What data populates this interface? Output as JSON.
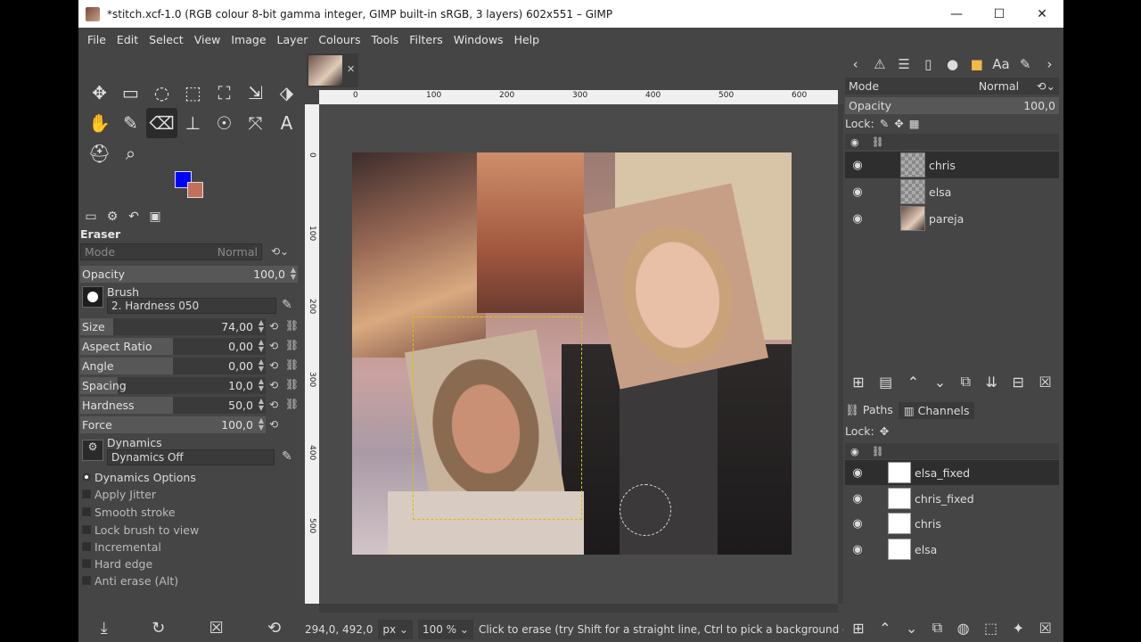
{
  "window": {
    "title": "*stitch.xcf-1.0 (RGB colour 8-bit gamma integer, GIMP built-in sRGB, 3 layers) 602x551 – GIMP",
    "minimize": "—",
    "maximize": "☐",
    "close": "✕"
  },
  "menu": [
    "File",
    "Edit",
    "Select",
    "View",
    "Image",
    "Layer",
    "Colours",
    "Tools",
    "Filters",
    "Windows",
    "Help"
  ],
  "tools": [
    "✥",
    "▭",
    "◌",
    "⬚",
    "⛶",
    "⇲",
    "⬗",
    "✋",
    "✎",
    "⌫",
    "⊥",
    "☉",
    "⤧",
    "A",
    "⛑",
    "⌕"
  ],
  "colors": {
    "foreground": "#0000ff",
    "background": "#c46e5c"
  },
  "tool_options": {
    "title": "Eraser",
    "mode_label": "Mode",
    "mode_value": "Normal",
    "opacity": {
      "label": "Opacity",
      "value": "100,0"
    },
    "brush_label": "Brush",
    "brush_value": "2. Hardness 050",
    "sliders": [
      {
        "label": "Size",
        "value": "74,00",
        "fraction": 0.18
      },
      {
        "label": "Aspect Ratio",
        "value": "0,00",
        "fraction": 0.5
      },
      {
        "label": "Angle",
        "value": "0,00",
        "fraction": 0.5
      },
      {
        "label": "Spacing",
        "value": "10,0",
        "fraction": 0.2
      },
      {
        "label": "Hardness",
        "value": "50,0",
        "fraction": 0.5
      },
      {
        "label": "Force",
        "value": "100,0",
        "fraction": 1.0
      }
    ],
    "dynamics_label": "Dynamics",
    "dynamics_value": "Dynamics Off",
    "options": [
      "Dynamics Options",
      "Apply Jitter",
      "Smooth stroke",
      "Lock brush to view",
      "Incremental",
      "Hard edge",
      "Anti erase  (Alt)"
    ]
  },
  "rulers": {
    "h": [
      "0",
      "100",
      "200",
      "300",
      "400",
      "500",
      "600"
    ],
    "v": [
      "0",
      "100",
      "200",
      "300",
      "400",
      "500"
    ]
  },
  "status": {
    "coords": "294,0, 492,0",
    "unit": "px",
    "zoom": "100 %",
    "message": "Click to erase (try Shift for a straight line, Ctrl to pick a background colour)"
  },
  "layers_panel": {
    "mode_label": "Mode",
    "mode_value": "Normal",
    "opacity_label": "Opacity",
    "opacity_value": "100,0",
    "lock_label": "Lock:",
    "layers": [
      {
        "name": "chris",
        "selected": true
      },
      {
        "name": "elsa",
        "selected": false
      },
      {
        "name": "pareja",
        "selected": false
      }
    ]
  },
  "channels_panel": {
    "tab_paths": "Paths",
    "tab_channels": "Channels",
    "lock_label": "Lock:",
    "channels": [
      {
        "name": "elsa_fixed",
        "selected": true
      },
      {
        "name": "chris_fixed",
        "selected": false
      },
      {
        "name": "chris",
        "selected": false
      },
      {
        "name": "elsa",
        "selected": false
      }
    ]
  }
}
